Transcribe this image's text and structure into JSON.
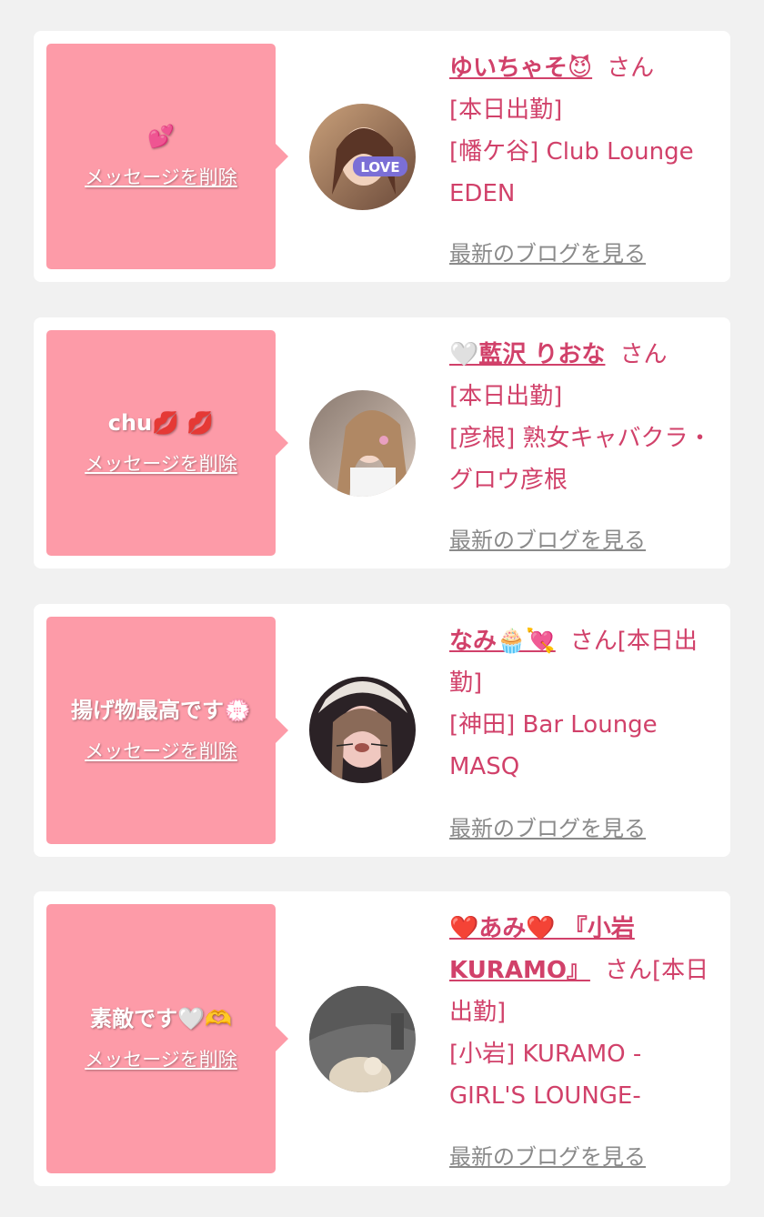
{
  "delete_label": "メッセージを削除",
  "blog_label": "最新のブログを見る",
  "honorific": "さん",
  "cards": [
    {
      "message": "💕",
      "name": "ゆいちゃそ😈",
      "status": "[本日出勤]",
      "shop": "[幡ケ谷] Club Lounge EDEN"
    },
    {
      "message": "chu💋 💋",
      "name": "🤍藍沢 りおな",
      "status": "[本日出勤]",
      "shop": "[彦根] 熟女キャバクラ・グロウ彦根"
    },
    {
      "message": "揚げ物最高です💮",
      "name": "なみ🧁💘",
      "status": "[本日出勤]",
      "shop": "[神田] Bar Lounge MASQ"
    },
    {
      "message": "素敵です🤍🫶",
      "name": "❤️あみ❤️ 『小岩KURAMO』",
      "status": "[本日出勤]",
      "shop": "[小岩] KURAMO -GIRL'S LOUNGE-"
    }
  ]
}
